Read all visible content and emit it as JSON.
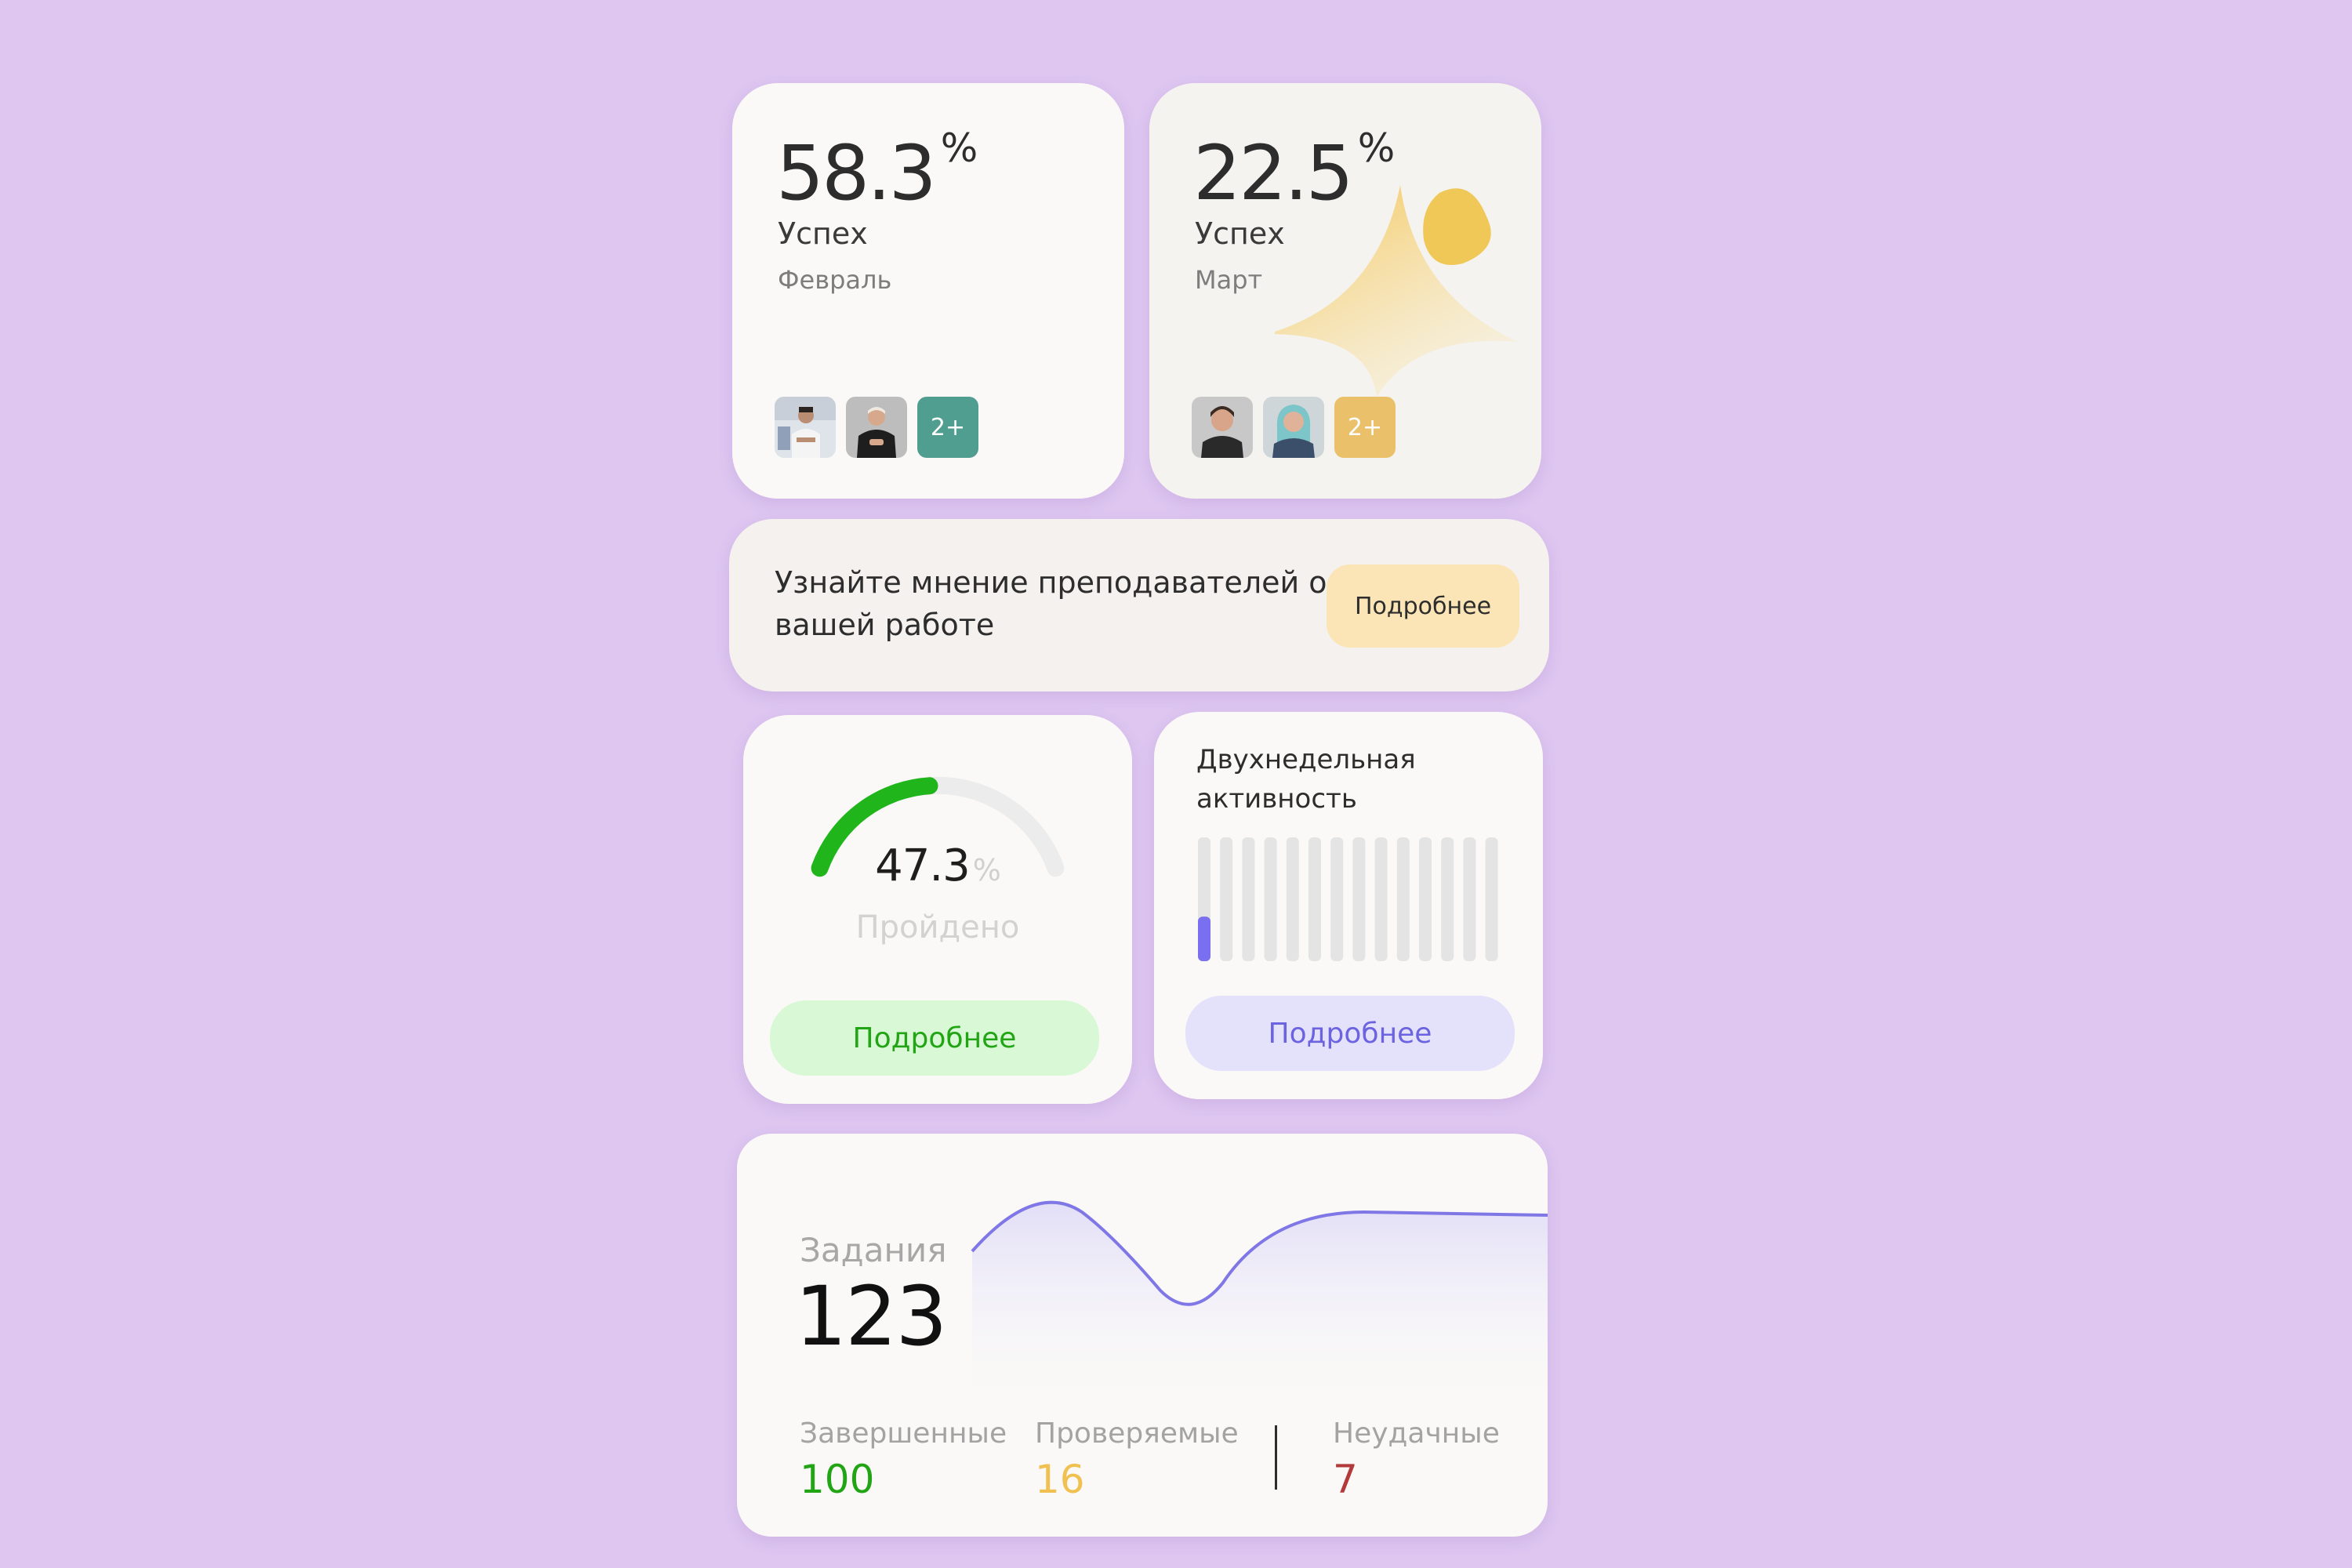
{
  "stats": [
    {
      "value": "58.3",
      "unit": "%",
      "label": "Успех",
      "month": "Февраль",
      "more": "2+",
      "more_color": "#4f9e8f"
    },
    {
      "value": "22.5",
      "unit": "%",
      "label": "Успех",
      "month": "Март",
      "more": "2+",
      "more_color": "#eac06a"
    }
  ],
  "banner": {
    "text": "Узнайте мнение преподавателей о вашей работе",
    "button": "Подробнее"
  },
  "progress": {
    "value": "47.3",
    "unit": "%",
    "label": "Пройдено",
    "fraction": 0.473,
    "button": "Подробнее",
    "accent": "#20b51a"
  },
  "activity": {
    "title": "Двухнедельная активность",
    "levels": [
      0.36,
      0,
      0,
      0,
      0,
      0,
      0,
      0,
      0,
      0,
      0,
      0,
      0,
      0
    ],
    "button": "Подробнее",
    "accent": "#7a6ff0"
  },
  "tasks": {
    "label": "Задания",
    "total": "123",
    "completed_label": "Завершенные",
    "completed": "100",
    "review_label": "Проверяемые",
    "review": "16",
    "failed_label": "Неудачные",
    "failed": "7"
  },
  "colors": {
    "background": "#dec6f1",
    "green": "#22a515",
    "yellow": "#f0c150",
    "red": "#b33a3a",
    "purple": "#6b63e0"
  }
}
